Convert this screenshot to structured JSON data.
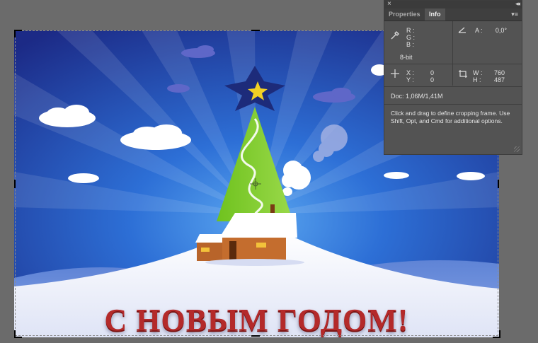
{
  "panel": {
    "close_glyph": "×",
    "collapse_glyph": "◂◂",
    "tabs": [
      {
        "label": "Properties",
        "active": false
      },
      {
        "label": "Info",
        "active": true
      }
    ],
    "menu_glyph": "▾≡",
    "color": {
      "icon": "eyedropper-icon",
      "r_label": "R :",
      "g_label": "G :",
      "b_label": "B :",
      "bit_depth": "8-bit"
    },
    "angle": {
      "icon": "angle-icon",
      "label": "A :",
      "value": "0,0°"
    },
    "position": {
      "icon": "crosshair-icon",
      "x_label": "X :",
      "x_value": "0",
      "y_label": "Y :",
      "y_value": "0"
    },
    "size": {
      "icon": "crop-size-icon",
      "w_label": "W :",
      "w_value": "760",
      "h_label": "H :",
      "h_value": "487"
    },
    "doc": "Doc: 1,06M/1,41M",
    "help": "Click and drag to define cropping frame. Use Shift, Opt, and Cmd for additional options."
  },
  "canvas": {
    "greeting": "С НОВЫМ ГОДОМ!",
    "colors": {
      "sky_top": "#1c2a86",
      "sky_bottom": "#2d6fd6",
      "tree": "#7dcf2a",
      "star": "#f2d024",
      "house": "#b8642a",
      "greeting": "#b42a2a"
    }
  }
}
